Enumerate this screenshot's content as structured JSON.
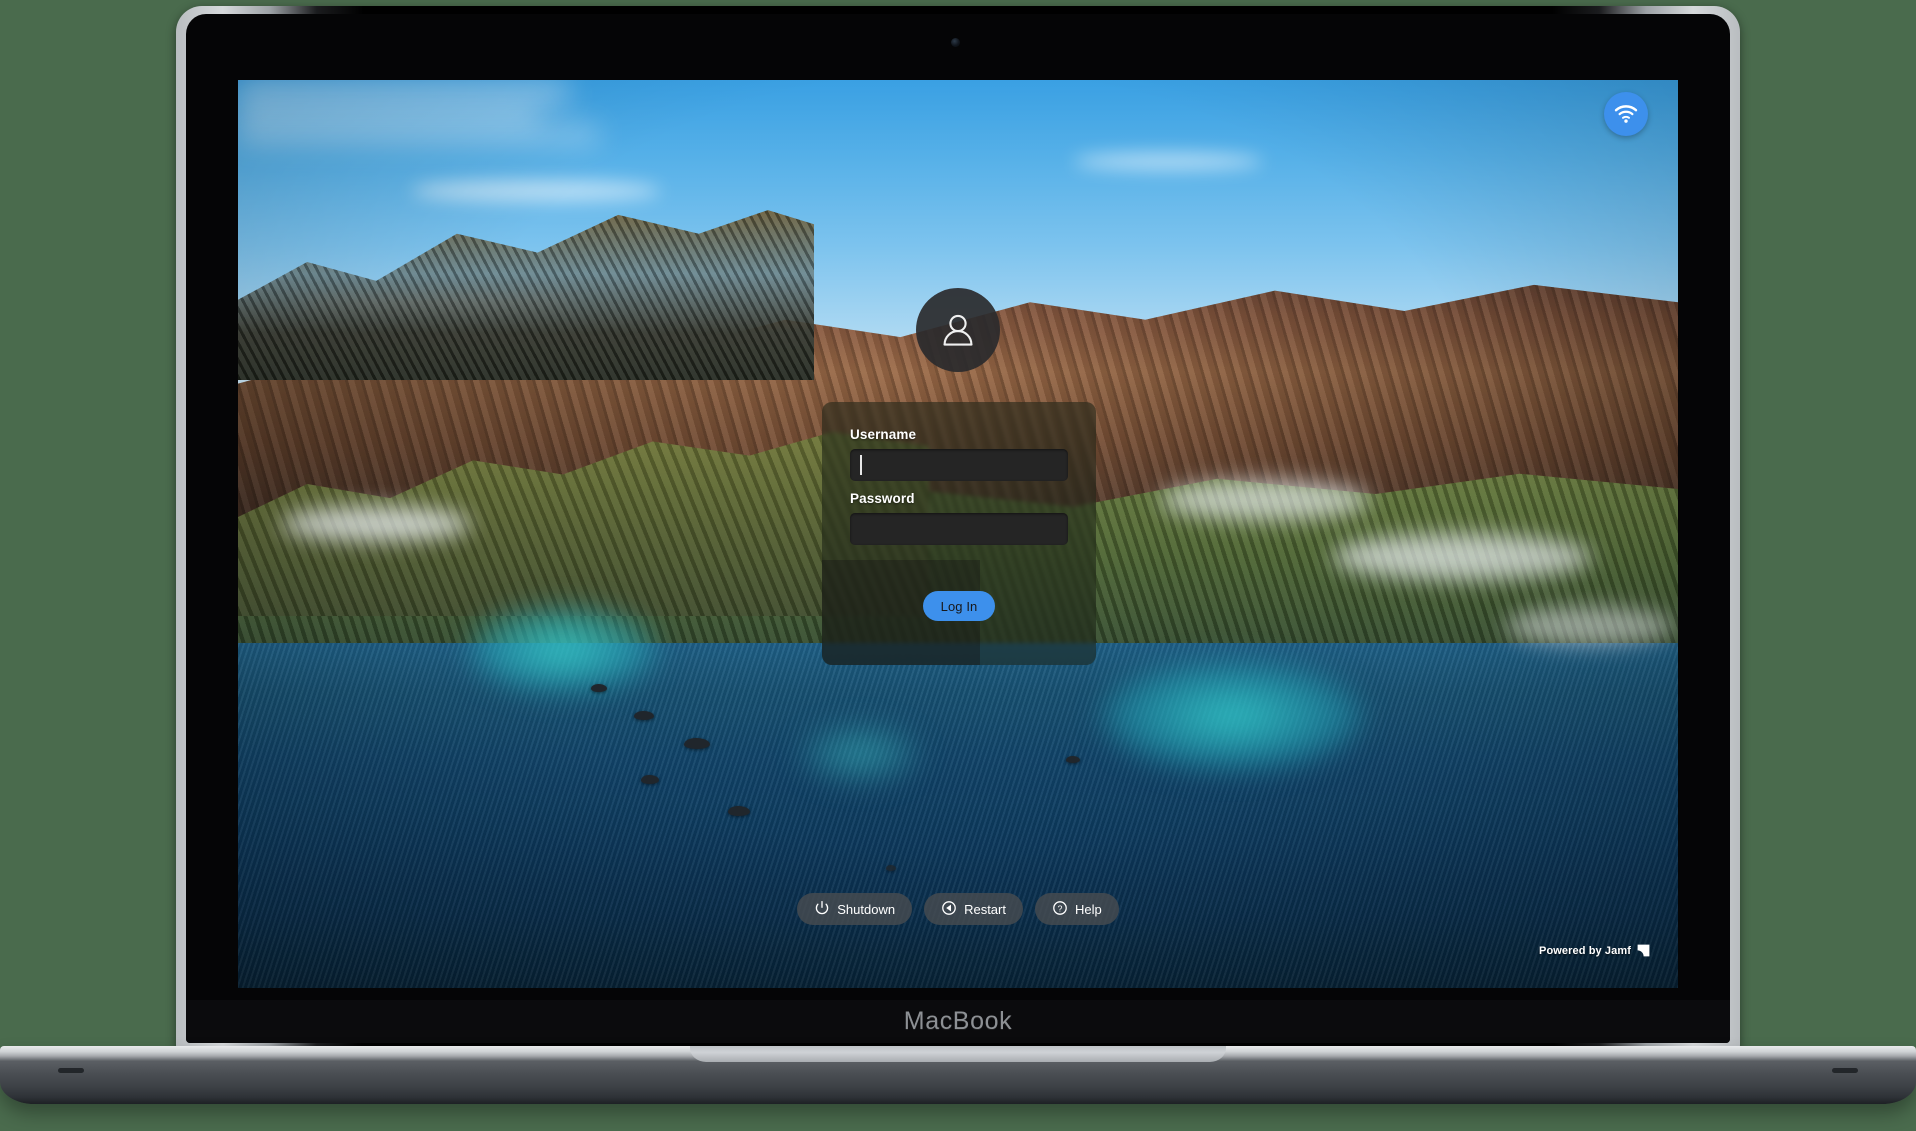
{
  "device": {
    "brand_label": "MacBook",
    "camera_icon": "camera-dot-icon"
  },
  "screen": {
    "wallpaper_name": "big-sur-coastline-wallpaper",
    "menu": {
      "wifi_icon": "wifi-icon",
      "wifi_accent": "#3d90ec"
    },
    "avatar": {
      "icon": "user-person-icon"
    },
    "login": {
      "username_label": "Username",
      "username_value": "",
      "username_placeholder": "",
      "password_label": "Password",
      "password_value": "",
      "password_placeholder": "",
      "login_button_label": "Log In",
      "login_button_color": "#3d90ec"
    },
    "actions": [
      {
        "label": "Shutdown",
        "icon": "power-icon"
      },
      {
        "label": "Restart",
        "icon": "restart-icon"
      },
      {
        "label": "Help",
        "icon": "question-mark-icon"
      }
    ],
    "credit": {
      "text": "Powered by Jamf",
      "logo_icon": "jamf-logo-icon"
    }
  }
}
